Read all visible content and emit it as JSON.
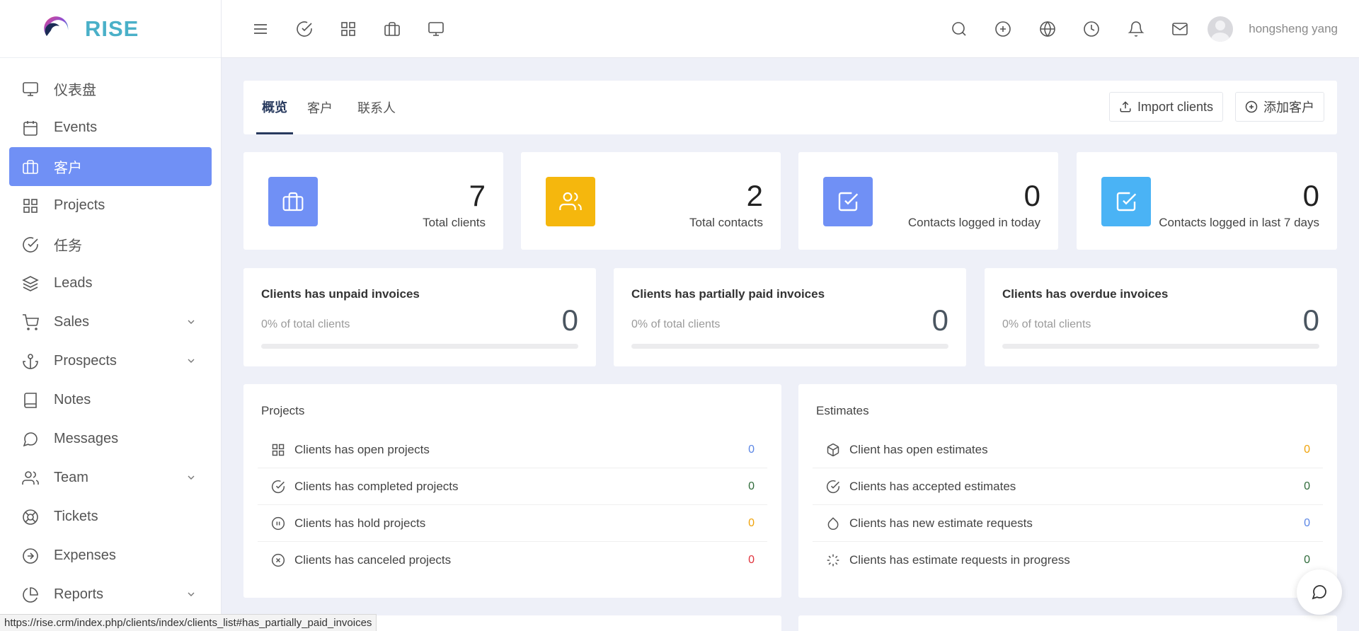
{
  "brand": {
    "name": "RISE"
  },
  "sidebar": {
    "items": [
      {
        "label": "仪表盘",
        "icon": "monitor-icon"
      },
      {
        "label": "Events",
        "icon": "calendar-icon"
      },
      {
        "label": "客户",
        "icon": "briefcase-icon",
        "active": true
      },
      {
        "label": "Projects",
        "icon": "grid-icon"
      },
      {
        "label": "任务",
        "icon": "check-circle-icon"
      },
      {
        "label": "Leads",
        "icon": "layers-icon"
      },
      {
        "label": "Sales",
        "icon": "cart-icon",
        "expandable": true
      },
      {
        "label": "Prospects",
        "icon": "anchor-icon",
        "expandable": true
      },
      {
        "label": "Notes",
        "icon": "book-icon"
      },
      {
        "label": "Messages",
        "icon": "message-icon"
      },
      {
        "label": "Team",
        "icon": "users-icon",
        "expandable": true
      },
      {
        "label": "Tickets",
        "icon": "life-buoy-icon"
      },
      {
        "label": "Expenses",
        "icon": "arrow-circle-icon"
      },
      {
        "label": "Reports",
        "icon": "pie-chart-icon",
        "expandable": true
      }
    ]
  },
  "topbar": {
    "user_name": "hongsheng yang"
  },
  "tabs": [
    {
      "label": "概览",
      "active": true
    },
    {
      "label": "客户"
    },
    {
      "label": "联系人"
    }
  ],
  "actions": {
    "import_label": "Import clients",
    "add_label": "添加客户"
  },
  "stats": [
    {
      "value": "7",
      "label": "Total clients",
      "color": "#7090f5",
      "icon": "briefcase-icon"
    },
    {
      "value": "2",
      "label": "Total contacts",
      "color": "#f5b70d",
      "icon": "users-icon"
    },
    {
      "value": "0",
      "label": "Contacts logged in today",
      "color": "#7090f5",
      "icon": "checkbox-icon"
    },
    {
      "value": "0",
      "label": "Contacts logged in last 7 days",
      "color": "#4ab3f5",
      "icon": "checkbox-icon"
    }
  ],
  "invoices": [
    {
      "title": "Clients has unpaid invoices",
      "sub": "0% of total clients",
      "value": "0",
      "percent": 0
    },
    {
      "title": "Clients has partially paid invoices",
      "sub": "0% of total clients",
      "value": "0",
      "percent": 0
    },
    {
      "title": "Clients has overdue invoices",
      "sub": "0% of total clients",
      "value": "0",
      "percent": 0
    }
  ],
  "projects": {
    "title": "Projects",
    "rows": [
      {
        "label": "Clients has open projects",
        "value": "0",
        "color": "#5b86e5",
        "icon": "grid-icon"
      },
      {
        "label": "Clients has completed projects",
        "value": "0",
        "color": "#2f6b3a",
        "icon": "check-circle-icon"
      },
      {
        "label": "Clients has hold projects",
        "value": "0",
        "color": "#f0a30a",
        "icon": "pause-circle-icon"
      },
      {
        "label": "Clients has canceled projects",
        "value": "0",
        "color": "#e0323c",
        "icon": "x-circle-icon"
      }
    ]
  },
  "estimates": {
    "title": "Estimates",
    "rows": [
      {
        "label": "Client has open estimates",
        "value": "0",
        "color": "#f0a30a",
        "icon": "box-icon"
      },
      {
        "label": "Clients has accepted estimates",
        "value": "0",
        "color": "#2f6b3a",
        "icon": "check-circle-icon"
      },
      {
        "label": "Clients has new estimate requests",
        "value": "0",
        "color": "#5b86e5",
        "icon": "droplet-icon"
      },
      {
        "label": "Clients has estimate requests in progress",
        "value": "0",
        "color": "#2f6b3a",
        "icon": "loader-icon"
      }
    ]
  },
  "status_url": "https://rise.crm/index.php/clients/index/clients_list#has_partially_paid_invoices"
}
